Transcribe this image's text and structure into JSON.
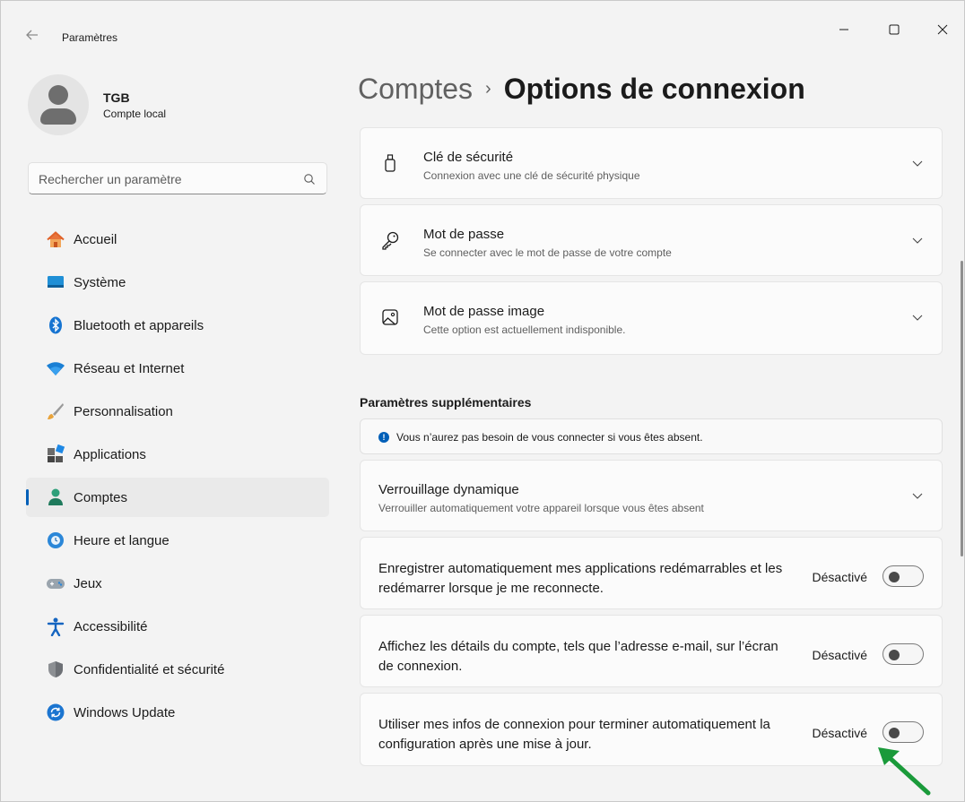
{
  "window": {
    "app_title": "Paramètres"
  },
  "profile": {
    "name": "TGB",
    "account_type": "Compte local"
  },
  "search": {
    "placeholder": "Rechercher un paramètre"
  },
  "sidebar": {
    "items": [
      {
        "label": "Accueil",
        "icon": "home-icon"
      },
      {
        "label": "Système",
        "icon": "system-icon"
      },
      {
        "label": "Bluetooth et appareils",
        "icon": "bluetooth-icon"
      },
      {
        "label": "Réseau et Internet",
        "icon": "wifi-icon"
      },
      {
        "label": "Personnalisation",
        "icon": "brush-icon"
      },
      {
        "label": "Applications",
        "icon": "apps-icon"
      },
      {
        "label": "Comptes",
        "icon": "accounts-icon",
        "active": true
      },
      {
        "label": "Heure et langue",
        "icon": "clock-globe-icon"
      },
      {
        "label": "Jeux",
        "icon": "gamepad-icon"
      },
      {
        "label": "Accessibilité",
        "icon": "accessibility-icon"
      },
      {
        "label": "Confidentialité et sécurité",
        "icon": "shield-icon"
      },
      {
        "label": "Windows Update",
        "icon": "update-icon"
      }
    ]
  },
  "breadcrumb": {
    "parent": "Comptes",
    "separator": "›",
    "current": "Options de connexion"
  },
  "options": [
    {
      "title": "Clé de sécurité",
      "subtitle": "Connexion avec une clé de sécurité physique",
      "icon": "usb-key-icon"
    },
    {
      "title": "Mot de passe",
      "subtitle": "Se connecter avec le mot de passe de votre compte",
      "icon": "key-icon"
    },
    {
      "title": "Mot de passe image",
      "subtitle": "Cette option est actuellement indisponible.",
      "icon": "picture-icon"
    }
  ],
  "additional": {
    "section_title": "Paramètres supplémentaires",
    "info": "Vous n’aurez pas besoin de vous connecter si vous êtes absent.",
    "dynamic_lock": {
      "title": "Verrouillage dynamique",
      "subtitle": "Verrouiller automatiquement votre appareil lorsque vous êtes absent"
    },
    "toggles": [
      {
        "text": "Enregistrer automatiquement mes applications redémarrables et les redémarrer lorsque je me reconnecte.",
        "state": "Désactivé",
        "on": false
      },
      {
        "text": "Affichez les détails du compte, tels que l’adresse e-mail, sur l’écran de connexion.",
        "state": "Désactivé",
        "on": false
      },
      {
        "text": "Utiliser mes infos de connexion pour terminer automatiquement la configuration après une mise à jour.",
        "state": "Désactivé",
        "on": false
      }
    ]
  },
  "colors": {
    "accent": "#005fb8",
    "annotation_arrow": "#1a9a3a"
  }
}
